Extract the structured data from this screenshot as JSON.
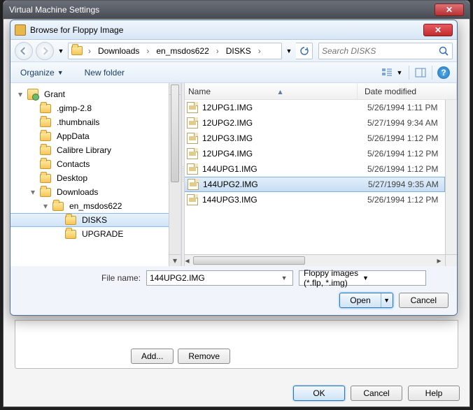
{
  "outer": {
    "title": "Virtual Machine Settings",
    "add_button": "Add...",
    "remove_button": "Remove",
    "ok": "OK",
    "cancel": "Cancel",
    "help": "Help"
  },
  "dialog": {
    "title": "Browse for Floppy Image",
    "breadcrumb": [
      "Downloads",
      "en_msdos622",
      "DISKS"
    ],
    "search_placeholder": "Search DISKS",
    "organize": "Organize",
    "new_folder": "New folder",
    "columns": {
      "name": "Name",
      "date": "Date modified"
    },
    "tree": [
      {
        "label": "Grant",
        "depth": 0,
        "icon": "user",
        "expandable": true
      },
      {
        "label": ".gimp-2.8",
        "depth": 1,
        "icon": "folder"
      },
      {
        "label": ".thumbnails",
        "depth": 1,
        "icon": "folder"
      },
      {
        "label": "AppData",
        "depth": 1,
        "icon": "folder"
      },
      {
        "label": "Calibre Library",
        "depth": 1,
        "icon": "folder"
      },
      {
        "label": "Contacts",
        "depth": 1,
        "icon": "folder"
      },
      {
        "label": "Desktop",
        "depth": 1,
        "icon": "folder"
      },
      {
        "label": "Downloads",
        "depth": 1,
        "icon": "folder",
        "expandable": true
      },
      {
        "label": "en_msdos622",
        "depth": 2,
        "icon": "folder",
        "expandable": true
      },
      {
        "label": "DISKS",
        "depth": 3,
        "icon": "folder",
        "selected": true
      },
      {
        "label": "UPGRADE",
        "depth": 3,
        "icon": "folder"
      }
    ],
    "files": [
      {
        "name": "12UPG1.IMG",
        "date": "5/26/1994 1:11 PM"
      },
      {
        "name": "12UPG2.IMG",
        "date": "5/27/1994 9:34 AM"
      },
      {
        "name": "12UPG3.IMG",
        "date": "5/26/1994 1:12 PM"
      },
      {
        "name": "12UPG4.IMG",
        "date": "5/26/1994 1:12 PM"
      },
      {
        "name": "144UPG1.IMG",
        "date": "5/26/1994 1:12 PM"
      },
      {
        "name": "144UPG2.IMG",
        "date": "5/27/1994 9:35 AM",
        "selected": true
      },
      {
        "name": "144UPG3.IMG",
        "date": "5/26/1994 1:12 PM"
      }
    ],
    "filename_label": "File name:",
    "filename_value": "144UPG2.IMG",
    "filter": "Floppy images (*.flp, *.img)",
    "open": "Open",
    "cancel": "Cancel"
  }
}
